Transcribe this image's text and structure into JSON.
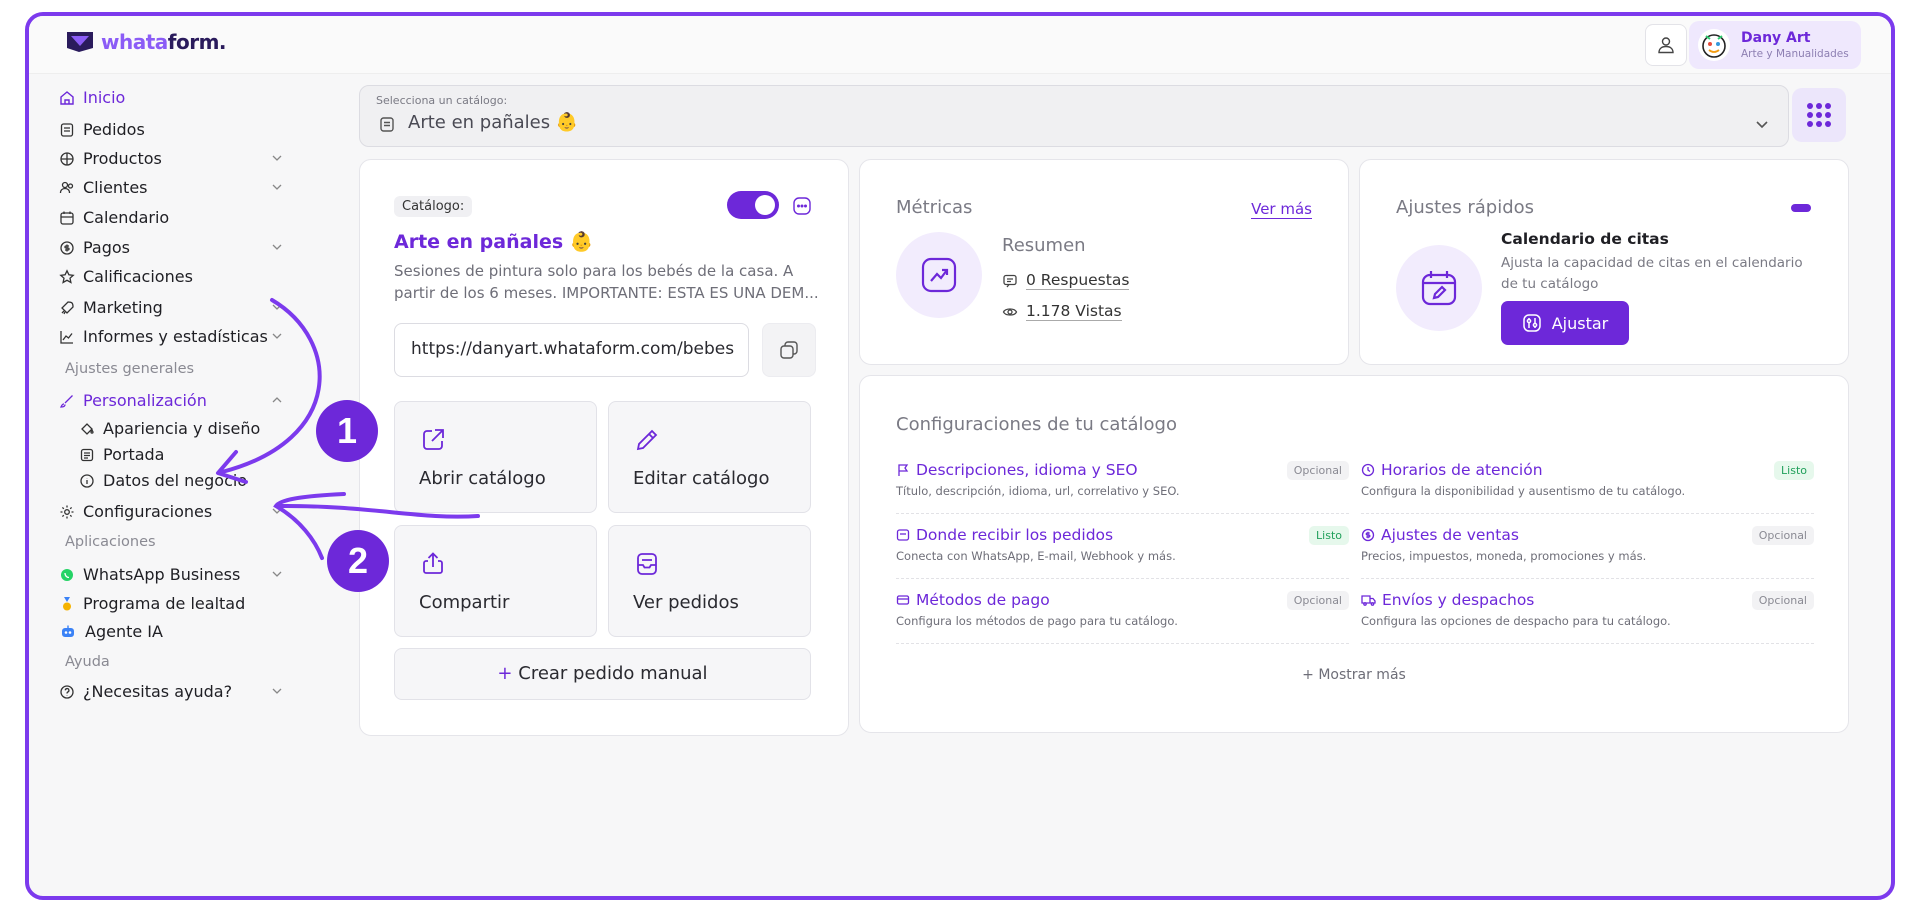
{
  "brand": {
    "logo_w": "whata",
    "logo_f": "form."
  },
  "account": {
    "name": "Dany Art",
    "subtitle": "Arte y Manualidades"
  },
  "sidebar": {
    "items": [
      {
        "label": "Inicio"
      },
      {
        "label": "Pedidos"
      },
      {
        "label": "Productos"
      },
      {
        "label": "Clientes"
      },
      {
        "label": "Calendario"
      },
      {
        "label": "Pagos"
      },
      {
        "label": "Calificaciones"
      },
      {
        "label": "Marketing"
      },
      {
        "label": "Informes y estadísticas"
      }
    ],
    "section_general": "Ajustes generales",
    "personalizacion": "Personalización",
    "sub_items": [
      {
        "label": "Apariencia y diseño"
      },
      {
        "label": "Portada"
      },
      {
        "label": "Datos del negocio"
      }
    ],
    "configuraciones": "Configuraciones",
    "section_apps": "Aplicaciones",
    "apps": [
      {
        "label": "WhatsApp Business"
      },
      {
        "label": "Programa de lealtad"
      },
      {
        "label": "Agente IA"
      }
    ],
    "section_help": "Ayuda",
    "help": "¿Necesitas ayuda?"
  },
  "selector": {
    "label": "Selecciona un catálogo:",
    "value": "Arte en pañales 👶"
  },
  "catalog": {
    "chip": "Catálogo:",
    "title": "Arte en pañales 👶",
    "description_line1": "Sesiones de pintura solo para los bebés de la casa. A",
    "description_line2": "partir de los 6 meses. IMPORTANTE: ESTA ES UNA DEM...",
    "url": "https://danyart.whataform.com/bebes",
    "tiles": {
      "open": "Abrir catálogo",
      "edit": "Editar catálogo",
      "share": "Compartir",
      "orders": "Ver pedidos"
    },
    "manual_plus": "+",
    "manual": "Crear pedido manual",
    "enabled": true
  },
  "metrics": {
    "title": "Métricas",
    "see_more": "Ver más",
    "summary": "Resumen",
    "responses": "0 Respuestas",
    "views": "1.178 Vistas"
  },
  "quick": {
    "title": "Ajustes rápidos",
    "item_title": "Calendario de citas",
    "item_desc": "Ajusta la capacidad de citas en el calendario de tu catálogo",
    "button": "Ajustar"
  },
  "config": {
    "title": "Configuraciones de tu catálogo",
    "items": [
      {
        "title": "Descripciones, idioma y SEO",
        "desc": "Título, descripción, idioma, url, correlativo y SEO.",
        "badge": "Opcional"
      },
      {
        "title": "Horarios de atención",
        "desc": "Configura la disponibilidad y ausentismo de tu catálogo.",
        "badge": "Listo"
      },
      {
        "title": "Donde recibir los pedidos",
        "desc": "Conecta con WhatsApp, E-mail, Webhook y más.",
        "badge": "Listo"
      },
      {
        "title": "Ajustes de ventas",
        "desc": "Precios, impuestos, moneda, promociones y más.",
        "badge": "Opcional"
      },
      {
        "title": "Métodos de pago",
        "desc": "Configura los métodos de pago para tu catálogo.",
        "badge": "Opcional"
      },
      {
        "title": "Envíos y despachos",
        "desc": "Configura las opciones de despacho para tu catálogo.",
        "badge": "Opcional"
      }
    ],
    "show_more": "+ Mostrar más"
  },
  "annotations": {
    "step1": "1",
    "step2": "2"
  },
  "colors": {
    "accent": "#6d28d9",
    "accent_light": "#8b5cf6",
    "ok": "#21a05b"
  }
}
